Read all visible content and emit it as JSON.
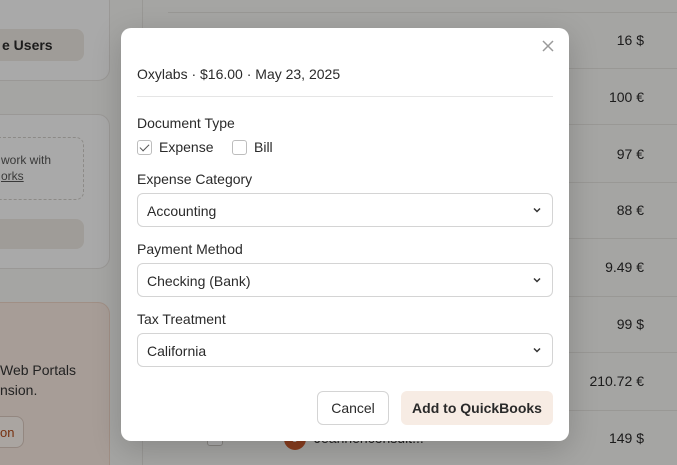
{
  "background": {
    "left_panel": {
      "manage_users_label": "e Users",
      "work_with_text": "work with",
      "works_link": "orks",
      "portal_line1": "Web Portals",
      "portal_line2": "nsion.",
      "portal_button": "on"
    },
    "amounts": [
      {
        "value": "16",
        "currency": "$"
      },
      {
        "value": "100",
        "currency": "€"
      },
      {
        "value": "97",
        "currency": "€"
      },
      {
        "value": "88",
        "currency": "€"
      },
      {
        "value": "9.49",
        "currency": "€"
      },
      {
        "value": "99",
        "currency": "$"
      },
      {
        "value": "210.72",
        "currency": "€"
      },
      {
        "value": "149",
        "currency": "$"
      }
    ],
    "last_row_name": "Jeannenconsult..."
  },
  "modal": {
    "title": "Oxylabs · $16.00 · May 23, 2025",
    "document_type": {
      "label": "Document Type",
      "options": [
        {
          "label": "Expense",
          "checked": true
        },
        {
          "label": "Bill",
          "checked": false
        }
      ]
    },
    "expense_category": {
      "label": "Expense Category",
      "value": "Accounting"
    },
    "payment_method": {
      "label": "Payment Method",
      "value": "Checking (Bank)"
    },
    "tax_treatment": {
      "label": "Tax Treatment",
      "value": "California"
    },
    "cancel_label": "Cancel",
    "submit_label": "Add to QuickBooks"
  },
  "colors": {
    "overlay": "#000000",
    "submit_bg": "#f7ece4",
    "avatar": "#c95a2e"
  },
  "icons": {
    "close": "close-icon",
    "dropdown": "chevron-down-icon",
    "check": "check-icon"
  }
}
